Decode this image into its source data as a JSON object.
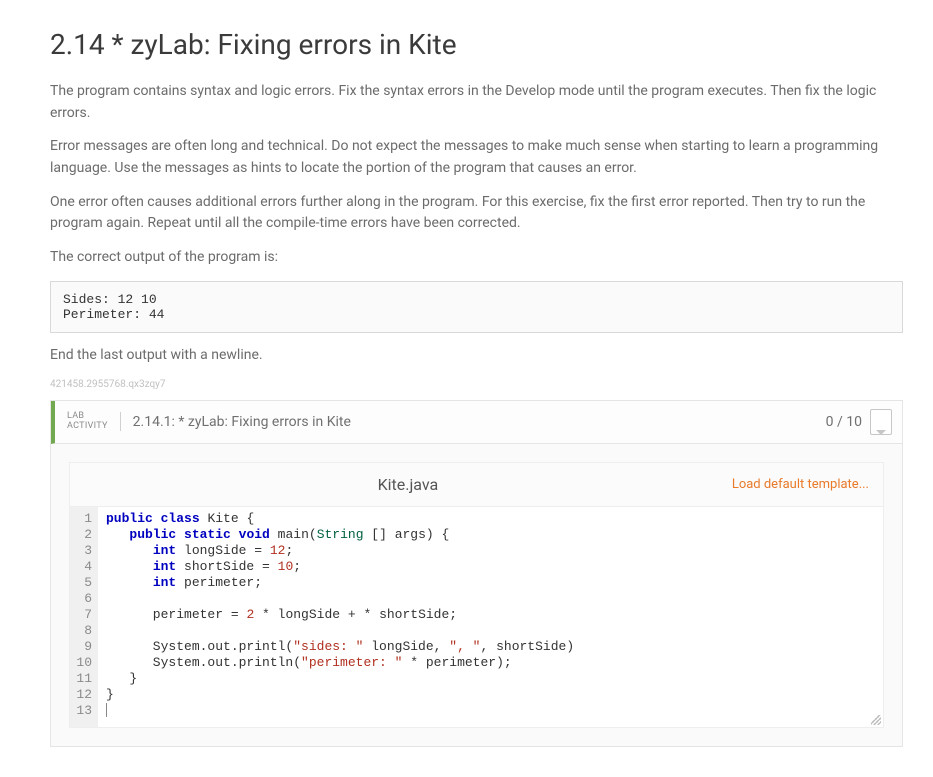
{
  "heading": "2.14 * zyLab: Fixing errors in Kite",
  "paragraphs": [
    "The program contains syntax and logic errors. Fix the syntax errors in the Develop mode until the program executes. Then fix the logic errors.",
    "Error messages are often long and technical. Do not expect the messages to make much sense when starting to learn a programming language. Use the messages as hints to locate the portion of the program that causes an error.",
    "One error often causes additional errors further along in the program. For this exercise, fix the first error reported. Then try to run the program again. Repeat until all the compile-time errors have been corrected.",
    "The correct output of the program is:"
  ],
  "expected_output": "Sides: 12 10\nPerimeter: 44",
  "post_expected": "End the last output with a newline.",
  "idstamp": "421458.2955768.qx3zqy7",
  "lab": {
    "label_line1": "LAB",
    "label_line2": "ACTIVITY",
    "title": "2.14.1: * zyLab: Fixing errors in Kite",
    "score": "0 / 10",
    "filename": "Kite.java",
    "load_default": "Load default template..."
  },
  "code": {
    "lines": [
      [
        {
          "t": "public",
          "c": "kw"
        },
        {
          "t": " "
        },
        {
          "t": "class",
          "c": "kw"
        },
        {
          "t": " Kite {"
        }
      ],
      [
        {
          "t": "   "
        },
        {
          "t": "public",
          "c": "kw"
        },
        {
          "t": " "
        },
        {
          "t": "static",
          "c": "kw"
        },
        {
          "t": " "
        },
        {
          "t": "void",
          "c": "kw"
        },
        {
          "t": " main("
        },
        {
          "t": "String",
          "c": "type"
        },
        {
          "t": " [] args) {"
        }
      ],
      [
        {
          "t": "      "
        },
        {
          "t": "int",
          "c": "kw"
        },
        {
          "t": " longSide = "
        },
        {
          "t": "12",
          "c": "num"
        },
        {
          "t": ";"
        }
      ],
      [
        {
          "t": "      "
        },
        {
          "t": "int",
          "c": "kw"
        },
        {
          "t": " shortSide = "
        },
        {
          "t": "10",
          "c": "num"
        },
        {
          "t": ";"
        }
      ],
      [
        {
          "t": "      "
        },
        {
          "t": "int",
          "c": "kw"
        },
        {
          "t": " perimeter;"
        }
      ],
      [
        {
          "t": ""
        }
      ],
      [
        {
          "t": "      perimeter = "
        },
        {
          "t": "2",
          "c": "num"
        },
        {
          "t": " * longSide + * shortSide;"
        }
      ],
      [
        {
          "t": ""
        }
      ],
      [
        {
          "t": "      System.out.printl("
        },
        {
          "t": "\"sides: \"",
          "c": "str"
        },
        {
          "t": " longSide, "
        },
        {
          "t": "\", \"",
          "c": "str"
        },
        {
          "t": ", shortSide)"
        }
      ],
      [
        {
          "t": "      System.out.println("
        },
        {
          "t": "\"perimeter: \"",
          "c": "str"
        },
        {
          "t": " * perimeter);"
        }
      ],
      [
        {
          "t": "   }"
        }
      ],
      [
        {
          "t": "}"
        }
      ],
      [
        {
          "t": ""
        }
      ]
    ]
  }
}
